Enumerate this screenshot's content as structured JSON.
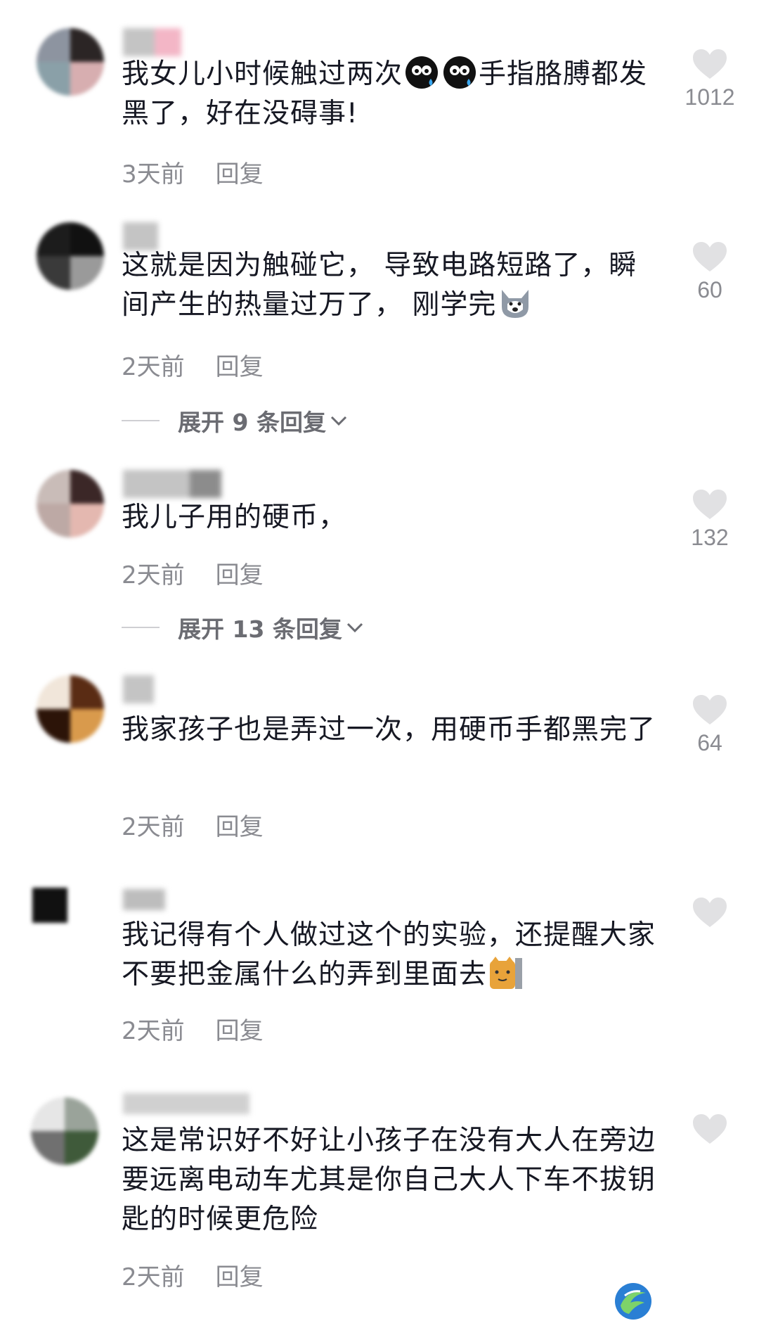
{
  "comments": [
    {
      "text_a": "我女儿小时候触过两次",
      "text_b": "手指胳膊都发黑了，好在没碍事!",
      "emojis": [
        "sweat-face-emoji",
        "sweat-face-emoji"
      ],
      "time": "3天前",
      "reply": "回复",
      "likes": "1012"
    },
    {
      "text_a": "这就是因为触碰它， 导致电路短路了，瞬间产生的热量过万了， 刚学完",
      "emojis": [
        "husky-dog-emoji"
      ],
      "time": "2天前",
      "reply": "回复",
      "likes": "60",
      "expand": "展开 9 条回复"
    },
    {
      "text_a": "我儿子用的硬币，",
      "time": "2天前",
      "reply": "回复",
      "likes": "132",
      "expand": "展开 13 条回复"
    },
    {
      "text_a": "我家孩子也是弄过一次，用硬币手都黑完了",
      "time": "2天前",
      "reply": "回复",
      "likes": "64"
    },
    {
      "text_a": "我记得有个人做过这个的实验，还提醒大家不要把金属什么的弄到里面去",
      "emojis": [
        "peeking-cat-emoji"
      ],
      "time": "2天前",
      "reply": "回复",
      "likes": ""
    },
    {
      "text_a": "这是常识好不好让小孩子在没有大人在旁边要远离电动车尤其是你自己大人下车不拔钥匙的时候更危险",
      "time": "2天前",
      "reply": "回复",
      "likes": ""
    }
  ],
  "colors": {
    "text": "#161823",
    "meta": "#8a8b91",
    "heart": "#e1e1e3",
    "expand": "#6b6c72"
  },
  "icons": {
    "heart": "heart-icon",
    "chevron": "chevron-down-icon",
    "watermark": "app-logo-icon"
  }
}
